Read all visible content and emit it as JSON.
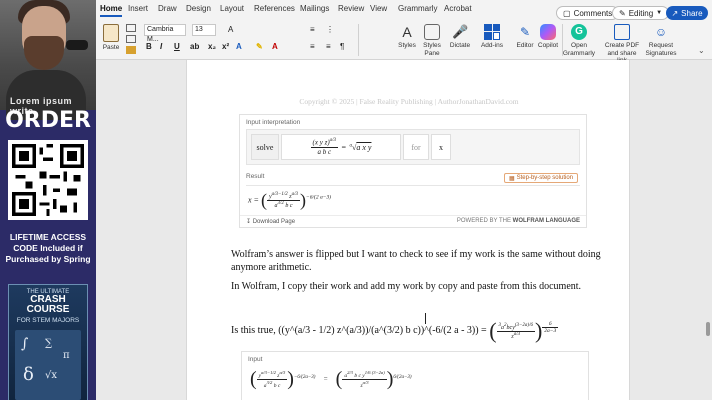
{
  "left_panel": {
    "webcam_text": "Lorem ipsum write",
    "order_label": "ORDER",
    "promo_lines": [
      "LIFETIME ACCESS",
      "CODE Included if",
      "Purchased by Spring"
    ],
    "book": {
      "the": "THE ULTIMATE",
      "title_line1": "CRASH COURSE",
      "title_line2": "FOR STEM MAJORS",
      "subtitle": ""
    }
  },
  "ribbon": {
    "tabs": [
      "Home",
      "Insert",
      "Draw",
      "Design",
      "Layout",
      "References",
      "Mailings",
      "Review",
      "View",
      "Grammarly",
      "Acrobat"
    ],
    "comments_label": "Comments",
    "editing_label": "Editing",
    "share_label": "Share",
    "paste_label": "Paste",
    "font_name": "Cambria M...",
    "font_size": "13",
    "buttons": {
      "styles": "Styles",
      "styles_pane_1": "Styles",
      "styles_pane_2": "Pane",
      "dictate": "Dictate",
      "addins": "Add-ins",
      "editor": "Editor",
      "copilot": "Copilot",
      "open_grammarly_1": "Open",
      "open_grammarly_2": "Grammarly",
      "create_pdf_1": "Create PDF",
      "create_pdf_2": "and share link",
      "request_sig_1": "Request",
      "request_sig_2": "Signatures"
    },
    "colors": {
      "accent": "#185abd",
      "grammarly": "#15c39a",
      "ribbon_bg": "#f3f3f3"
    }
  },
  "document": {
    "copyright": "Copyright © 2025 | False Reality Publishing | AuthorJonathanDavid.com",
    "wolfram1": {
      "input_label": "Input interpretation",
      "solve": "solve",
      "for": "for",
      "var": "x",
      "result_label": "Result",
      "step_button": "Step-by-step solution",
      "download": "Download Page",
      "powered_by_prefix": "POWERED BY THE",
      "powered_by_brand": "WOLFRAM LANGUAGE"
    },
    "paragraph1": "Wolfram’s answer is flipped but I want to check to see if my work is the same without doing anymore arithmetic.",
    "paragraph2": "In Wolfram, I copy their work and add my work by copy and paste from this document.",
    "is_this_true": "Is this true, ((y^(a/3 - 1/2) z^(a/3))/(a^(3/2) b c))^(-6/(2 a - 3)) =",
    "wolfram2": {
      "input_label": "Input"
    }
  }
}
